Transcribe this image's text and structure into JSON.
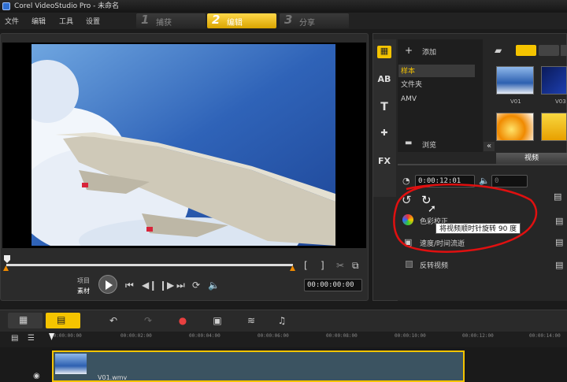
{
  "window": {
    "title": "Corel VideoStudio Pro - 未命名"
  },
  "menu": {
    "file": "文件",
    "edit": "编辑",
    "tools": "工具",
    "settings": "设置"
  },
  "steps": [
    {
      "num": "1",
      "label": "捕获"
    },
    {
      "num": "2",
      "label": "编辑"
    },
    {
      "num": "3",
      "label": "分享"
    }
  ],
  "player": {
    "mode_project": "项目",
    "mode_clip": "素材",
    "timecode": "00:00:00:00",
    "trim_in": "[",
    "trim_out": "]"
  },
  "library": {
    "add_label": "添加",
    "tree": [
      "样本",
      "文件夹",
      "AMV"
    ],
    "browse_label": "浏览",
    "thumbs": [
      {
        "caption": "V01"
      },
      {
        "caption": "V03"
      }
    ]
  },
  "options": {
    "tab_label": "视频",
    "duration": "0:00:12:01",
    "volume": "0",
    "rotate_tooltip": "将视频顺时针旋转 90 度",
    "color_correction": "色彩校正",
    "speed_label": "速度/时间流逝",
    "reverse_label": "反转视频"
  },
  "timeline": {
    "ruler": [
      "00:00:00:00",
      "00:00:02:00",
      "00:00:04:00",
      "00:00:06:00",
      "00:00:08:00",
      "00:00:10:00",
      "00:00:12:00",
      "00:00:14:00"
    ],
    "clip_name": "V01.wmv"
  },
  "colors": {
    "accent": "#f5c400",
    "annotation": "#e01010",
    "sky": "#2f63b8"
  }
}
